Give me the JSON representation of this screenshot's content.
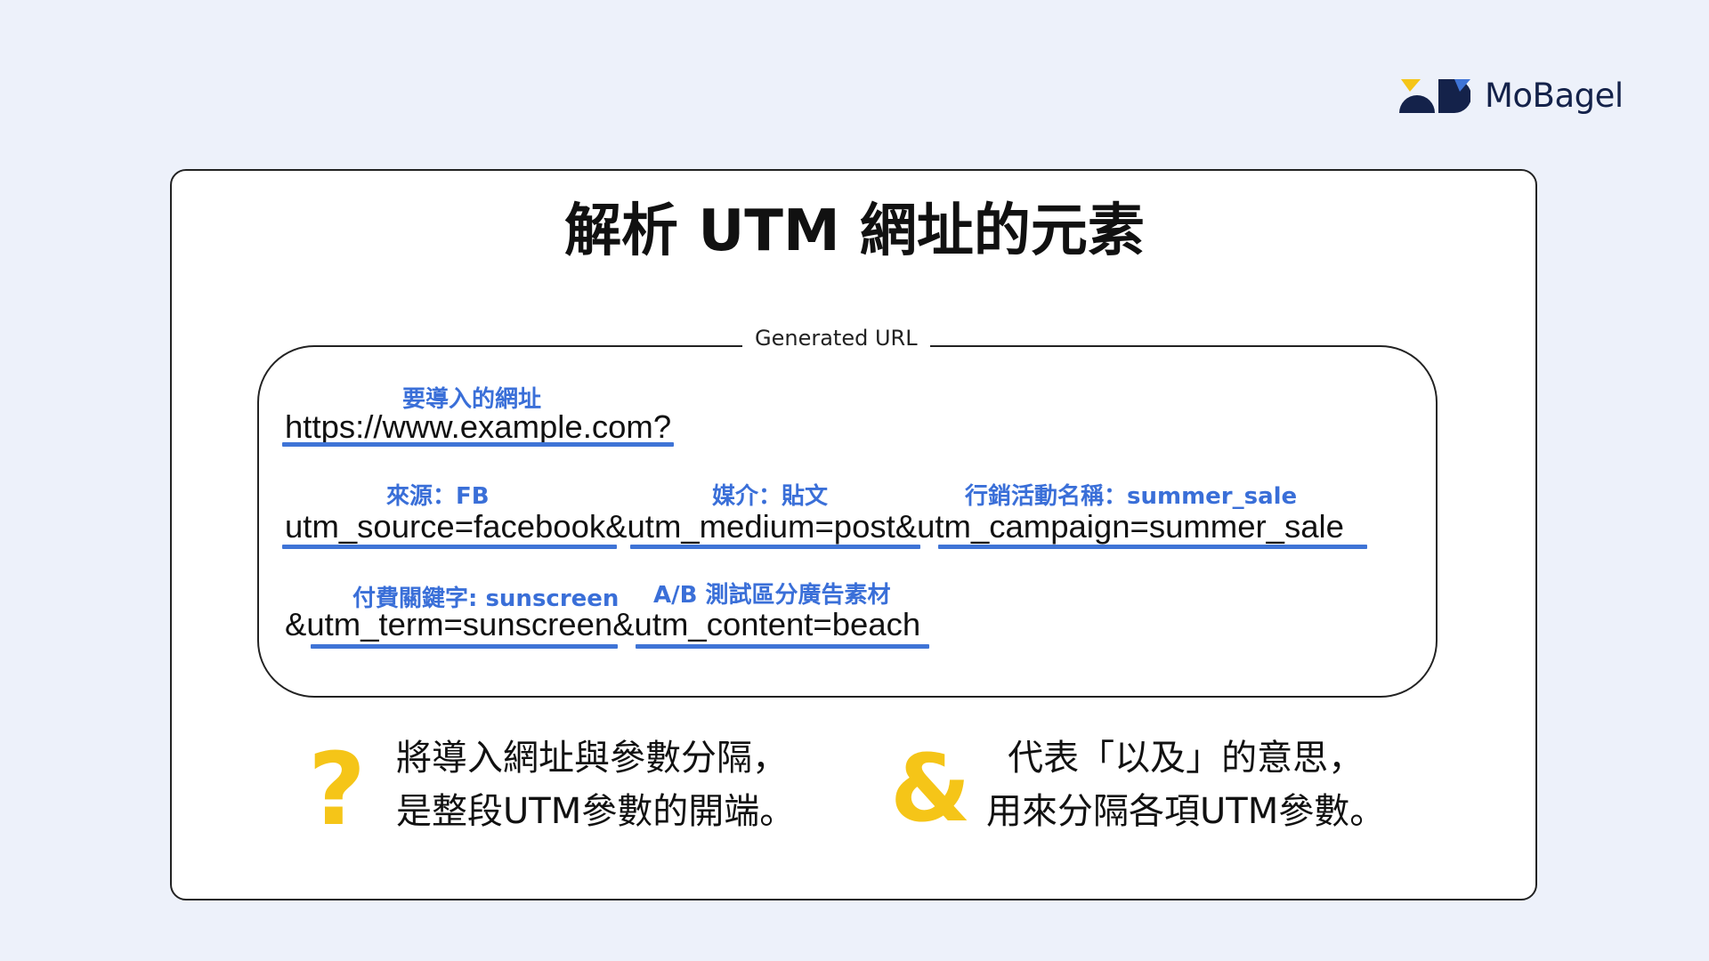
{
  "brand": {
    "name": "MoBagel"
  },
  "title": "解析 UTM 網址的元素",
  "url_box": {
    "legend": "Generated URL"
  },
  "lines": [
    "https://www.example.com?",
    "utm_source=facebook&utm_medium=post&utm_campaign=summer_sale",
    "&utm_term=sunscreen&utm_content=beach"
  ],
  "notes": {
    "landing": "要導入的網址",
    "source": "來源：FB",
    "medium": "媒介：貼文",
    "campaign": "行銷活動名稱：summer_sale",
    "term": "付費關鍵字: sunscreen",
    "content": "A/B 測試區分廣告素材"
  },
  "explanations": [
    {
      "symbol": "?",
      "line1": "將導入網址與參數分隔，",
      "line2": "是整段UTM參數的開端。"
    },
    {
      "symbol": "&",
      "line1": "代表「以及」的意思，",
      "line2": "用來分隔各項UTM參數。"
    }
  ],
  "colors": {
    "accent": "#3f74d6",
    "symbol": "#f5c518",
    "brand_dark": "#14224a",
    "background": "#edf1fa"
  }
}
